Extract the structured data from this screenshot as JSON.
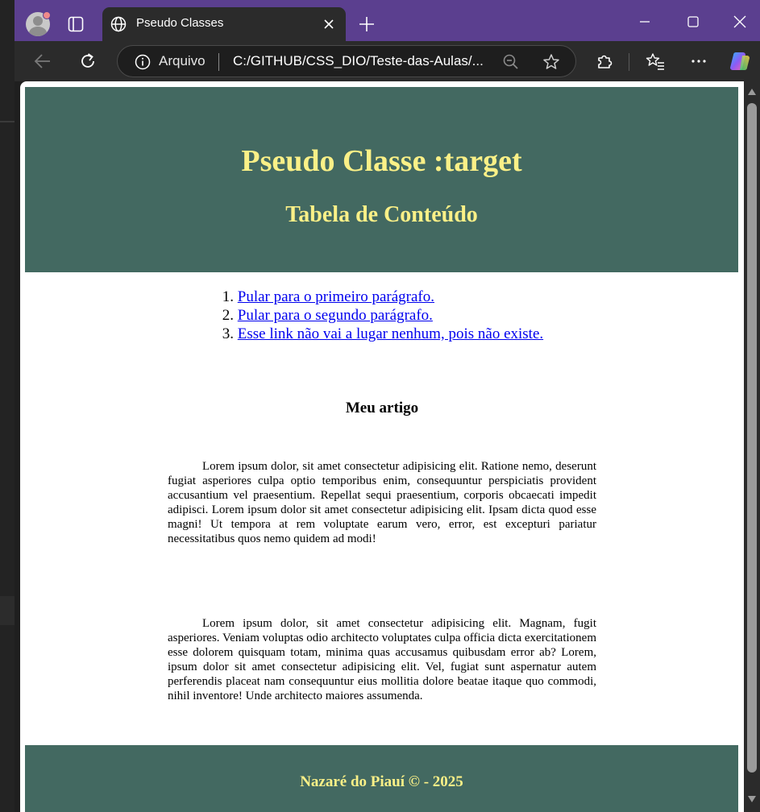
{
  "browser": {
    "tab_title": "Pseudo Classes",
    "site_label": "Arquivo",
    "url": "C:/GITHUB/CSS_DIO/Teste-das-Aulas/..."
  },
  "page": {
    "header_title": "Pseudo Classe :target",
    "header_subtitle": "Tabela de Conteúdo",
    "toc": [
      {
        "num": "1.",
        "text": "Pular para o primeiro parágrafo."
      },
      {
        "num": "2.",
        "text": "Pular para o segundo parágrafo."
      },
      {
        "num": "3.",
        "text": "Esse link não vai a lugar nenhum, pois não existe."
      }
    ],
    "article_title": "Meu artigo",
    "paragraph1": "Lorem ipsum dolor, sit amet consectetur adipisicing elit. Ratione nemo, deserunt fugiat asperiores culpa optio temporibus enim, consequuntur perspiciatis provident accusantium vel praesentium. Repellat sequi praesentium, corporis obcaecati impedit adipisci. Lorem ipsum dolor sit amet consectetur adipisicing elit. Ipsam dicta quod esse magni! Ut tempora at rem voluptate earum vero, error, est excepturi pariatur necessitatibus quos nemo quidem ad modi!",
    "paragraph2": "Lorem ipsum dolor, sit amet consectetur adipisicing elit. Magnam, fugit asperiores. Veniam voluptas odio architecto voluptates culpa officia dicta exercitationem esse dolorem quisquam totam, minima quas accusamus quibusdam error ab? Lorem, ipsum dolor sit amet consectetur adipisicing elit. Vel, fugiat sunt aspernatur autem perferendis placeat nam consequuntur eius mollitia dolore beatae itaque quo commodi, nihil inventore! Unde architecto maiores assumenda.",
    "footer_text": "Nazaré do Piauí © - 2025"
  },
  "colors": {
    "titlebar": "#5b3f8f",
    "header_bg": "#436961",
    "header_text": "#faf087",
    "link": "#0000ee"
  }
}
